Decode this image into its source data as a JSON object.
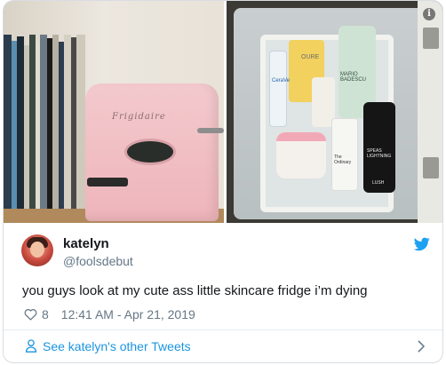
{
  "media": {
    "left_image": {
      "fridge_brand": "Frigidaire"
    },
    "right_image": {
      "product_labels": [
        "OURE",
        "MARIO BADESCU",
        "CeraVe",
        "The Ordinary",
        "SPEAS LIGHTNING",
        "LUSH"
      ]
    },
    "info_badge": "i"
  },
  "tweet": {
    "display_name": "katelyn",
    "handle": "@foolsdebut",
    "text": "you guys look at my cute ass little skincare fridge i’m dying",
    "like_count": "8",
    "timestamp": "12:41 AM - Apr 21, 2019"
  },
  "footer": {
    "link_label": "See katelyn's other Tweets"
  },
  "colors": {
    "twitter_blue": "#1da1f2",
    "link_blue": "#1b95e0",
    "secondary_text": "#657786",
    "fridge_pink": "#f3c9cd"
  },
  "icons": [
    "info-icon",
    "twitter-bird-icon",
    "heart-icon",
    "person-icon",
    "chevron-right-icon"
  ]
}
